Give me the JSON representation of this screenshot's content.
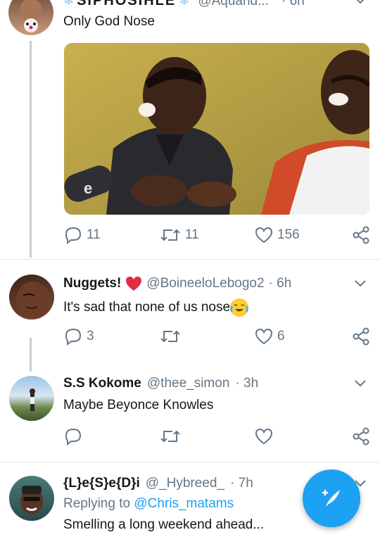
{
  "tweet1": {
    "name": "SIPHOSIHLE",
    "handle": "@Aquand...",
    "time": "· 6h",
    "text": "Only God Nose",
    "replies": "11",
    "retweets": "11",
    "likes": "156"
  },
  "tweet2": {
    "name": "Nuggets!",
    "handle": "@BoineeloLebogo2",
    "time": "· 6h",
    "text": "It's sad that none of us nose",
    "replies": "3",
    "retweets": "",
    "likes": "6"
  },
  "tweet3": {
    "name": "S.S Kokome",
    "handle": "@thee_simon",
    "time": "· 3h",
    "text": "Maybe Beyonce Knowles"
  },
  "tweet4": {
    "name": "{L}e{S}e{D}i",
    "handle": "@_Hybreed_",
    "time": "· 7h",
    "replying_prefix": "Replying to",
    "replying_to": "@Chris_matams",
    "text": "Smelling a long weekend ahead..."
  },
  "colors": {
    "accent": "#1da1f2",
    "muted": "#657786",
    "heart": "#e0245e"
  },
  "icons": [
    "reply-icon",
    "retweet-icon",
    "like-icon",
    "share-icon",
    "chevron-down-icon",
    "compose-tweet-icon",
    "crying-laughing-emoji",
    "heart-emoji"
  ]
}
